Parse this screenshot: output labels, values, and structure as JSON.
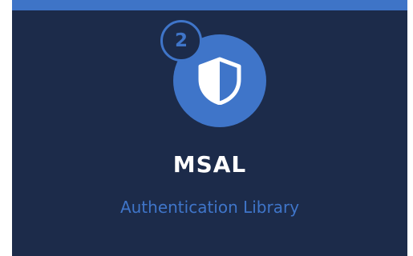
{
  "step": {
    "number": "2"
  },
  "card": {
    "title": "MSAL",
    "subtitle": "Authentication Library",
    "icon": "shield-icon"
  },
  "colors": {
    "background": "#1c2b4a",
    "accent": "#3f75c9",
    "top_border": "#3e74c7",
    "title_text": "#ffffff"
  }
}
